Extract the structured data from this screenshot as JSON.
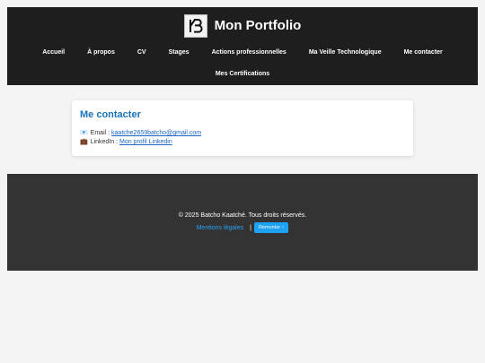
{
  "header": {
    "title": "Mon Portfolio",
    "logo_icon": "kb-monogram-logo",
    "nav": [
      {
        "label": "Accueil"
      },
      {
        "label": "À propos"
      },
      {
        "label": "CV"
      },
      {
        "label": "Stages"
      },
      {
        "label": "Actions professionnelles"
      },
      {
        "label": "Ma Veille Technologique"
      },
      {
        "label": "Me contacter"
      },
      {
        "label": "Mes Certifications"
      }
    ]
  },
  "contact": {
    "title": "Me contacter",
    "email": {
      "icon": "email-icon",
      "glyph": "📧",
      "label": "Email :",
      "value": "kaatche2659batcho@gmail.com"
    },
    "linkedin": {
      "icon": "briefcase-icon",
      "glyph": "💼",
      "label": "LinkedIn :",
      "value": "Mon profil Linkedin"
    }
  },
  "footer": {
    "copyright": "© 2025 Batcho Kaatché. Tous droits réservés.",
    "legal_label": "Mentions légales",
    "separator": "|",
    "top_button_label": "Remonter ↑"
  },
  "colors": {
    "header_bg": "#1e1e1e",
    "footer_bg": "#333333",
    "page_bg": "#f4f4f4",
    "accent_title": "#1a73b8",
    "link": "#1a66c2",
    "footer_link": "#29a3f5",
    "button_bg": "#1da1f2"
  }
}
